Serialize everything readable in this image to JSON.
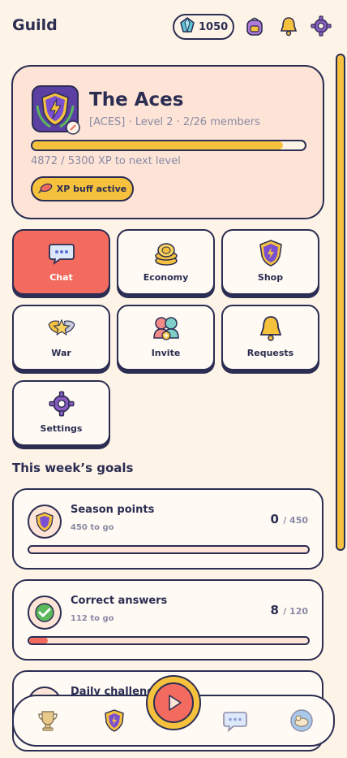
{
  "header": {
    "title": "Guild",
    "gems": "1050",
    "icons": [
      "gem-icon",
      "backpack-icon",
      "bell-icon",
      "gear-icon"
    ]
  },
  "guild": {
    "name": "The Aces",
    "meta": "[ACES] · Level 2 · 2/26 members",
    "xp_text": "4872 / 5300 XP to next level",
    "xp_current": 4872,
    "xp_needed": 5300,
    "buff_label": "XP buff active",
    "colors": {
      "card": "#fde4d6",
      "xp_fill": "#f6c23e",
      "accent": "#f26b5e"
    }
  },
  "tiles": [
    {
      "label": "Chat",
      "icon": "chat-bubble-icon",
      "active": true
    },
    {
      "label": "Economy",
      "icon": "coins-icon",
      "active": false
    },
    {
      "label": "Shop",
      "icon": "shop-emblem-icon",
      "active": false
    },
    {
      "label": "War",
      "icon": "war-stars-icon",
      "active": false
    },
    {
      "label": "Invite",
      "icon": "invite-people-icon",
      "active": false
    },
    {
      "label": "Requests",
      "icon": "bell-icon",
      "active": false
    },
    {
      "label": "Settings",
      "icon": "gear-icon",
      "active": false
    }
  ],
  "goals": {
    "section_title": "This week’s goals",
    "items": [
      {
        "title": "Season points",
        "sub": "450 to go",
        "current": "0",
        "target": "/ 450",
        "icon": "trophy-badge-icon"
      },
      {
        "title": "Correct answers",
        "sub": "112 to go",
        "current": "8",
        "target": "/ 120",
        "icon": "check-circle-icon"
      },
      {
        "title": "Daily challeng",
        "icon": "daily-challenge-icon"
      }
    ]
  },
  "bottom_nav": {
    "items": [
      "trophy-icon",
      "guild-emblem-icon",
      "play-icon",
      "chat-icon",
      "profile-icon"
    ]
  }
}
